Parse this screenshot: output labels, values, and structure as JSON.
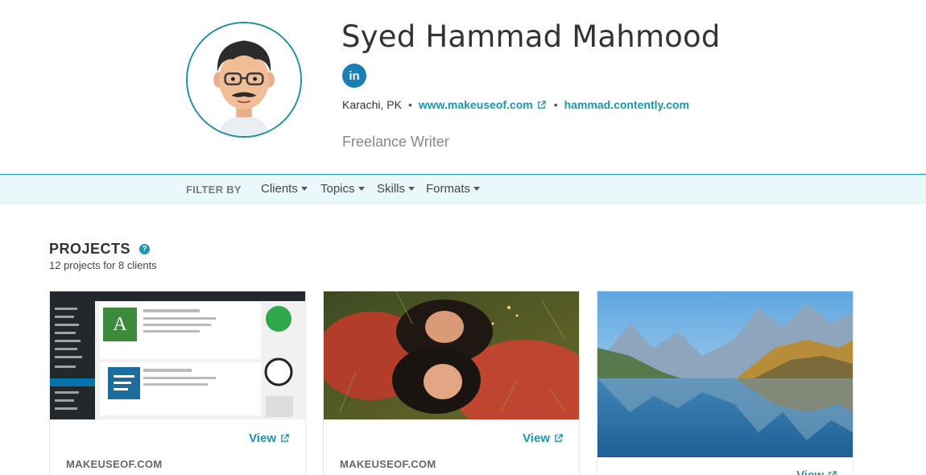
{
  "profile": {
    "name": "Syed Hammad Mahmood",
    "linkedin_label": "in",
    "location": "Karachi, PK",
    "website": "www.makeuseof.com",
    "portfolio": "hammad.contently.com",
    "role": "Freelance Writer"
  },
  "filter": {
    "label": "FILTER BY",
    "items": [
      "Clients",
      "Topics",
      "Skills",
      "Formats"
    ]
  },
  "projects": {
    "title": "PROJECTS",
    "help_icon": "question-circle-icon",
    "subtitle": "12 projects for 8 clients",
    "cards": [
      {
        "view_label": "View",
        "client": "MAKEUSEOF.COM",
        "image": "wordpress-plugins-screenshot"
      },
      {
        "view_label": "View",
        "client": "MAKEUSEOF.COM",
        "image": "two-women-lying-in-grass"
      },
      {
        "view_label": "View",
        "client": "",
        "image": "mountain-lake-landscape"
      }
    ]
  },
  "colors": {
    "accent": "#1a96b0",
    "linkedin": "#1a7fb5",
    "filter_bg": "#ebf8fb"
  }
}
